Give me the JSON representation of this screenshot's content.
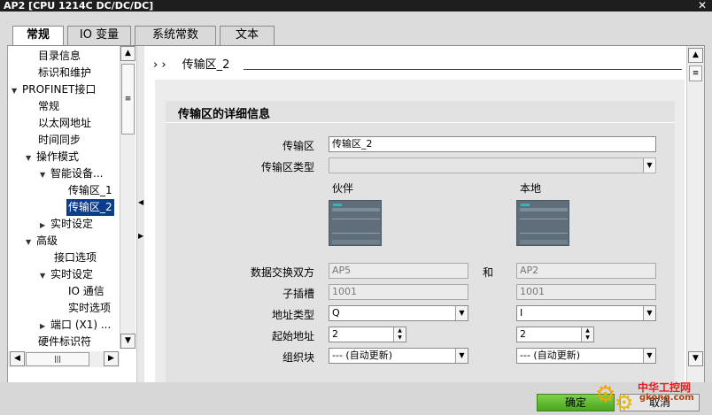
{
  "window": {
    "title": "AP2 [CPU 1214C DC/DC/DC]",
    "close_glyph": "✕"
  },
  "tabs": [
    {
      "label": "常规",
      "active": true
    },
    {
      "label": "IO 变量",
      "active": false
    },
    {
      "label": "系统常数",
      "active": false
    },
    {
      "label": "文本",
      "active": false
    }
  ],
  "nav": {
    "items": [
      {
        "label": "目录信息",
        "expander": "",
        "selected": false
      },
      {
        "label": "标识和维护",
        "expander": "",
        "selected": false
      },
      {
        "label": "PROFINET接口",
        "expander": "▼",
        "selected": false
      },
      {
        "label": "常规",
        "expander": "",
        "selected": false
      },
      {
        "label": "以太网地址",
        "expander": "",
        "selected": false
      },
      {
        "label": "时间同步",
        "expander": "",
        "selected": false
      },
      {
        "label": "操作模式",
        "expander": "▼",
        "selected": false
      },
      {
        "label": "智能设备...",
        "expander": "▼",
        "selected": false
      },
      {
        "label": "传输区_1",
        "expander": "",
        "selected": false
      },
      {
        "label": "传输区_2",
        "expander": "",
        "selected": true
      },
      {
        "label": "实时设定",
        "expander": "▶",
        "selected": false
      },
      {
        "label": "高级",
        "expander": "▼",
        "selected": false
      },
      {
        "label": "接口选项",
        "expander": "",
        "selected": false
      },
      {
        "label": "实时设定",
        "expander": "▼",
        "selected": false
      },
      {
        "label": "IO 通信",
        "expander": "",
        "selected": false
      },
      {
        "label": "实时选项",
        "expander": "",
        "selected": false
      },
      {
        "label": "端口 (X1) ...",
        "expander": "▶",
        "selected": false
      },
      {
        "label": "硬件标识符",
        "expander": "",
        "selected": false
      }
    ],
    "scroll_up": "▲",
    "scroll_down": "▼",
    "scroll_left": "◀",
    "scroll_right": "▶",
    "thumb_grip": "≡",
    "hthumb_grip": "|||"
  },
  "splitter": {
    "arrow_left": "◀",
    "arrow_right": "▶"
  },
  "breadcrumb": {
    "arrows": "› ›",
    "current": "传输区_2"
  },
  "section": {
    "title": "传输区的详细信息"
  },
  "form": {
    "transfer_area_label": "传输区",
    "transfer_area_value": "传输区_2",
    "transfer_area_type_label": "传输区类型",
    "transfer_area_type_value": "",
    "partner_header": "伙伴",
    "local_header": "本地",
    "exchange_label": "数据交换双方",
    "partner_device": "AP5",
    "and_label": "和",
    "local_device": "AP2",
    "slot_label": "子插槽",
    "partner_slot": "1001",
    "local_slot": "1001",
    "addr_type_label": "地址类型",
    "partner_addr_type": "Q",
    "local_addr_type": "I",
    "start_addr_label": "起始地址",
    "partner_start_addr": "2",
    "local_start_addr": "2",
    "ob_label": "组织块",
    "partner_ob": "--- (自动更新)",
    "local_ob": "--- (自动更新)"
  },
  "right_scroll": {
    "up": "▲",
    "down": "▼",
    "grip": "≡"
  },
  "buttons": {
    "ok": "确定",
    "cancel": "取消"
  },
  "watermark": {
    "text1": "中华工控网",
    "text2": "gkong.com"
  },
  "colors": {
    "selection": "#0c3c8c",
    "ok_button": "#5cb82a"
  }
}
